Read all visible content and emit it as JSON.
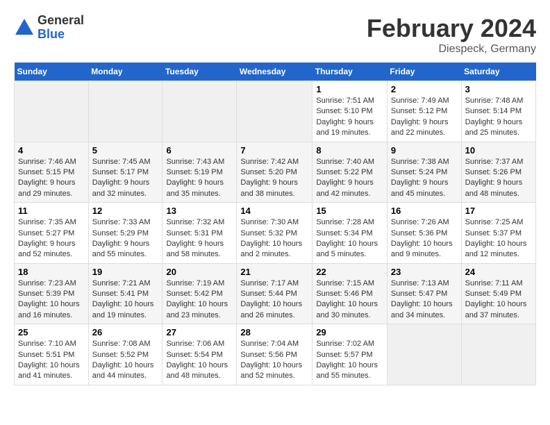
{
  "logo": {
    "general": "General",
    "blue": "Blue"
  },
  "title": "February 2024",
  "subtitle": "Diespeck, Germany",
  "days_of_week": [
    "Sunday",
    "Monday",
    "Tuesday",
    "Wednesday",
    "Thursday",
    "Friday",
    "Saturday"
  ],
  "weeks": [
    [
      {
        "day": "",
        "info": ""
      },
      {
        "day": "",
        "info": ""
      },
      {
        "day": "",
        "info": ""
      },
      {
        "day": "",
        "info": ""
      },
      {
        "day": "1",
        "info": "Sunrise: 7:51 AM\nSunset: 5:10 PM\nDaylight: 9 hours\nand 19 minutes."
      },
      {
        "day": "2",
        "info": "Sunrise: 7:49 AM\nSunset: 5:12 PM\nDaylight: 9 hours\nand 22 minutes."
      },
      {
        "day": "3",
        "info": "Sunrise: 7:48 AM\nSunset: 5:14 PM\nDaylight: 9 hours\nand 25 minutes."
      }
    ],
    [
      {
        "day": "4",
        "info": "Sunrise: 7:46 AM\nSunset: 5:15 PM\nDaylight: 9 hours\nand 29 minutes."
      },
      {
        "day": "5",
        "info": "Sunrise: 7:45 AM\nSunset: 5:17 PM\nDaylight: 9 hours\nand 32 minutes."
      },
      {
        "day": "6",
        "info": "Sunrise: 7:43 AM\nSunset: 5:19 PM\nDaylight: 9 hours\nand 35 minutes."
      },
      {
        "day": "7",
        "info": "Sunrise: 7:42 AM\nSunset: 5:20 PM\nDaylight: 9 hours\nand 38 minutes."
      },
      {
        "day": "8",
        "info": "Sunrise: 7:40 AM\nSunset: 5:22 PM\nDaylight: 9 hours\nand 42 minutes."
      },
      {
        "day": "9",
        "info": "Sunrise: 7:38 AM\nSunset: 5:24 PM\nDaylight: 9 hours\nand 45 minutes."
      },
      {
        "day": "10",
        "info": "Sunrise: 7:37 AM\nSunset: 5:26 PM\nDaylight: 9 hours\nand 48 minutes."
      }
    ],
    [
      {
        "day": "11",
        "info": "Sunrise: 7:35 AM\nSunset: 5:27 PM\nDaylight: 9 hours\nand 52 minutes."
      },
      {
        "day": "12",
        "info": "Sunrise: 7:33 AM\nSunset: 5:29 PM\nDaylight: 9 hours\nand 55 minutes."
      },
      {
        "day": "13",
        "info": "Sunrise: 7:32 AM\nSunset: 5:31 PM\nDaylight: 9 hours\nand 58 minutes."
      },
      {
        "day": "14",
        "info": "Sunrise: 7:30 AM\nSunset: 5:32 PM\nDaylight: 10 hours\nand 2 minutes."
      },
      {
        "day": "15",
        "info": "Sunrise: 7:28 AM\nSunset: 5:34 PM\nDaylight: 10 hours\nand 5 minutes."
      },
      {
        "day": "16",
        "info": "Sunrise: 7:26 AM\nSunset: 5:36 PM\nDaylight: 10 hours\nand 9 minutes."
      },
      {
        "day": "17",
        "info": "Sunrise: 7:25 AM\nSunset: 5:37 PM\nDaylight: 10 hours\nand 12 minutes."
      }
    ],
    [
      {
        "day": "18",
        "info": "Sunrise: 7:23 AM\nSunset: 5:39 PM\nDaylight: 10 hours\nand 16 minutes."
      },
      {
        "day": "19",
        "info": "Sunrise: 7:21 AM\nSunset: 5:41 PM\nDaylight: 10 hours\nand 19 minutes."
      },
      {
        "day": "20",
        "info": "Sunrise: 7:19 AM\nSunset: 5:42 PM\nDaylight: 10 hours\nand 23 minutes."
      },
      {
        "day": "21",
        "info": "Sunrise: 7:17 AM\nSunset: 5:44 PM\nDaylight: 10 hours\nand 26 minutes."
      },
      {
        "day": "22",
        "info": "Sunrise: 7:15 AM\nSunset: 5:46 PM\nDaylight: 10 hours\nand 30 minutes."
      },
      {
        "day": "23",
        "info": "Sunrise: 7:13 AM\nSunset: 5:47 PM\nDaylight: 10 hours\nand 34 minutes."
      },
      {
        "day": "24",
        "info": "Sunrise: 7:11 AM\nSunset: 5:49 PM\nDaylight: 10 hours\nand 37 minutes."
      }
    ],
    [
      {
        "day": "25",
        "info": "Sunrise: 7:10 AM\nSunset: 5:51 PM\nDaylight: 10 hours\nand 41 minutes."
      },
      {
        "day": "26",
        "info": "Sunrise: 7:08 AM\nSunset: 5:52 PM\nDaylight: 10 hours\nand 44 minutes."
      },
      {
        "day": "27",
        "info": "Sunrise: 7:06 AM\nSunset: 5:54 PM\nDaylight: 10 hours\nand 48 minutes."
      },
      {
        "day": "28",
        "info": "Sunrise: 7:04 AM\nSunset: 5:56 PM\nDaylight: 10 hours\nand 52 minutes."
      },
      {
        "day": "29",
        "info": "Sunrise: 7:02 AM\nSunset: 5:57 PM\nDaylight: 10 hours\nand 55 minutes."
      },
      {
        "day": "",
        "info": ""
      },
      {
        "day": "",
        "info": ""
      }
    ]
  ]
}
